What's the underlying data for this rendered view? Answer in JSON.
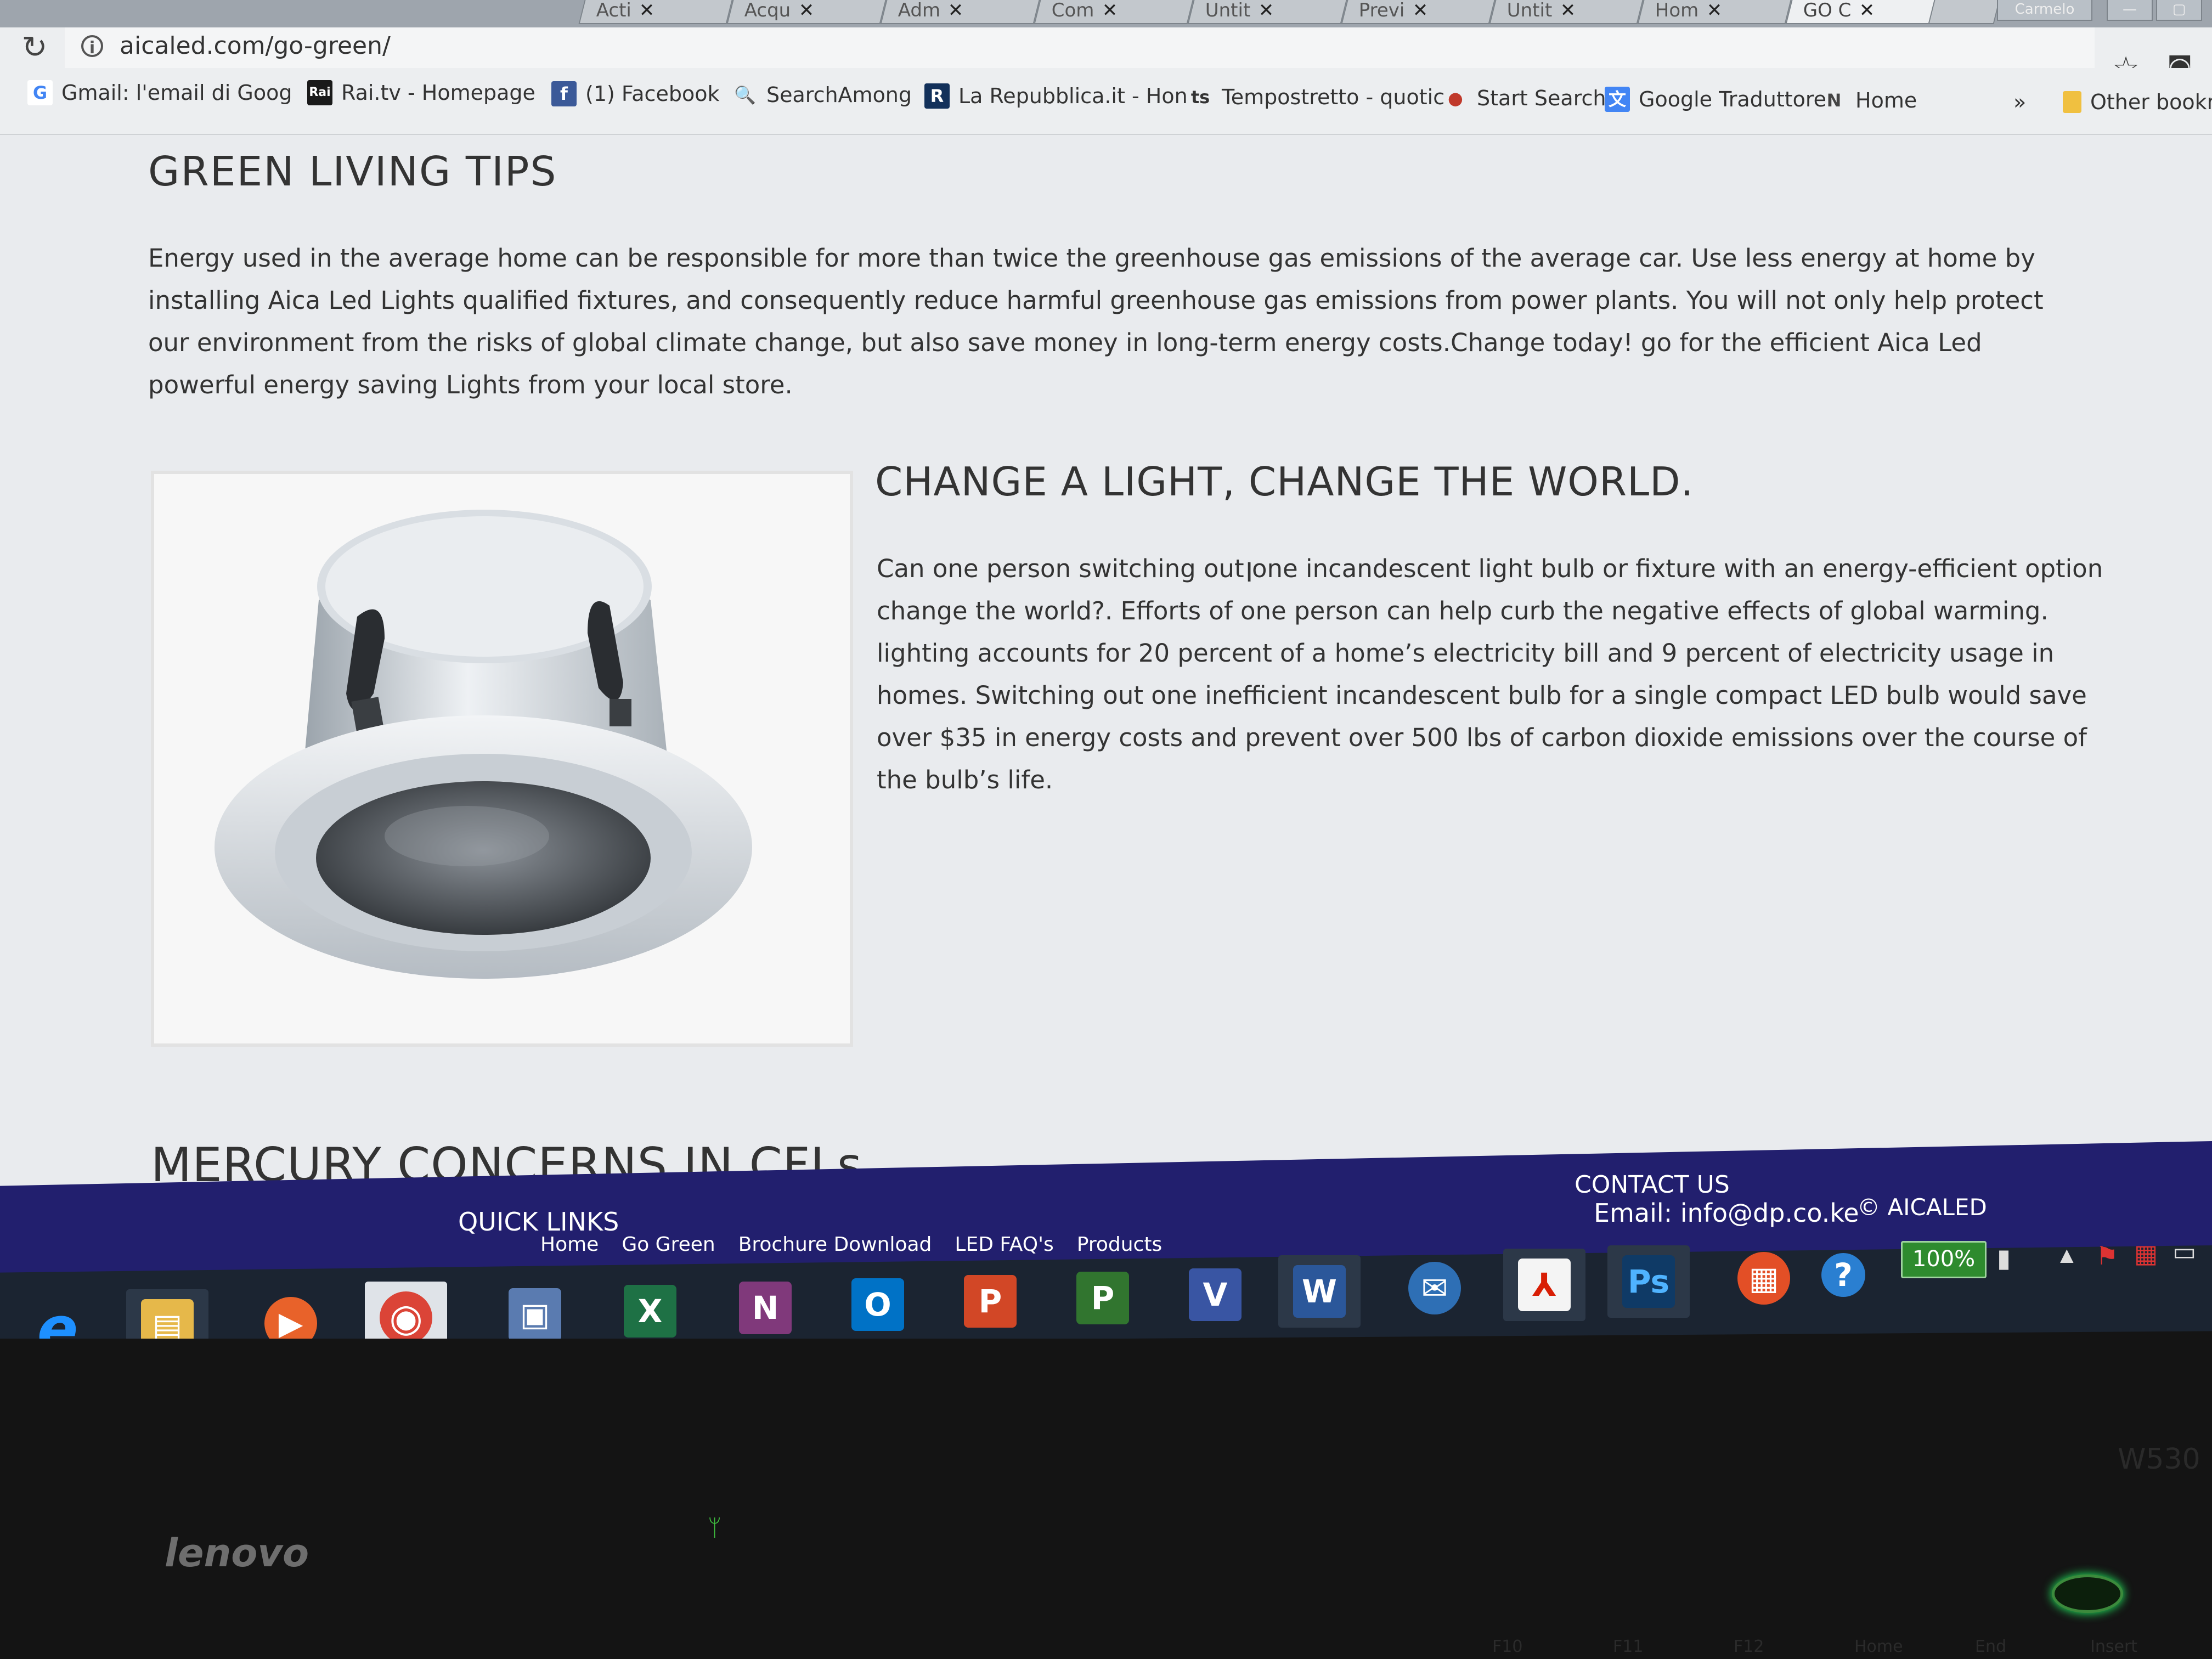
{
  "browser": {
    "tabs": [
      {
        "label": "Acti",
        "icon": "generic-tab-icon"
      },
      {
        "label": "Acqu",
        "icon": "google-icon"
      },
      {
        "label": "Adm",
        "icon": "admin-icon"
      },
      {
        "label": "Com",
        "icon": "pdf-icon"
      },
      {
        "label": "Untit",
        "icon": "doc-icon"
      },
      {
        "label": "Previ",
        "icon": "google-icon"
      },
      {
        "label": "Untit",
        "icon": "doc-icon"
      },
      {
        "label": "Hom",
        "icon": "doc-icon"
      },
      {
        "label": "GO C",
        "icon": "page-icon"
      }
    ],
    "profile_button": "Carmelo",
    "url": "aicaled.com/go-green/",
    "bookmarks": [
      {
        "label": "Gmail: l'email di Goog",
        "icon": "G",
        "color": "#4285f4"
      },
      {
        "label": "Rai.tv - Homepage",
        "icon": "Rai",
        "color": "#1a1a1a"
      },
      {
        "label": "(1) Facebook",
        "icon": "f",
        "color": "#3b5998"
      },
      {
        "label": "SearchAmong",
        "icon": "🔍",
        "color": "#3a78c3"
      },
      {
        "label": "La Repubblica.it - Hon",
        "icon": "R",
        "color": "#12305a"
      },
      {
        "label": "Tempostretto - quotic",
        "icon": "ts",
        "color": "#333333"
      },
      {
        "label": "Start Search",
        "icon": "●",
        "color": "#c0392b"
      },
      {
        "label": "Google Traduttore",
        "icon": "文",
        "color": "#4285f4"
      },
      {
        "label": "Home",
        "icon": "N",
        "color": "#444444"
      }
    ],
    "bookmarks_overflow": "»",
    "other_bookmarks": "Other bookma"
  },
  "page": {
    "title": "GREEN LIVING TIPS",
    "intro": "Energy used in the average home can be responsible for more than twice the greenhouse gas emissions of the average car. Use less energy at home by installing Aica Led Lights qualified fixtures, and consequently reduce harmful greenhouse gas emissions from power plants. You will not only help protect our environment from the risks of global climate change, but also save money in long-term energy costs.Change today! go for the efficient Aica Led powerful energy saving Lights from your local store.",
    "section_title": "CHANGE A LIGHT, CHANGE THE WORLD.",
    "section_text": "Can one person switching out one incandescent light bulb or fixture with an energy-efficient option change the world?. Efforts of one person can help curb the negative effects of global warming. lighting accounts for 20 percent of a home’s electricity bill and 9 percent of electricity usage in homes. Switching out one inefficient incandescent bulb for a single compact LED bulb would save over $35 in energy costs and prevent over 500 lbs of carbon dioxide emissions over the course of the bulb’s life.",
    "next_section_title": "MERCURY CONCERNS IN CFLs"
  },
  "footer": {
    "quick_links_title": "QUICK LINKS",
    "links": [
      "Home",
      "Go Green",
      "Brochure Download",
      "LED FAQ's",
      "Products"
    ],
    "contact_title": "CONTACT US",
    "email": "Email: info@dp.co.ke",
    "copyright": "© AICALED"
  },
  "taskbar": {
    "apps": [
      {
        "name": "internet-explorer-icon",
        "glyph": "e",
        "color": "#1e90ff"
      },
      {
        "name": "file-explorer-icon",
        "glyph": "▤",
        "color": "#e6b84a"
      },
      {
        "name": "media-player-icon",
        "glyph": "▶",
        "color": "#e8622a"
      },
      {
        "name": "chrome-icon",
        "glyph": "◉",
        "color": "#db4437"
      },
      {
        "name": "app-launcher-icon",
        "glyph": "▣",
        "color": "#5a7bb0"
      },
      {
        "name": "excel-icon",
        "glyph": "X",
        "color": "#1e7145"
      },
      {
        "name": "onenote-icon",
        "glyph": "N",
        "color": "#80397b"
      },
      {
        "name": "outlook-icon",
        "glyph": "O",
        "color": "#0072c6"
      },
      {
        "name": "powerpoint-icon",
        "glyph": "P",
        "color": "#d24726"
      },
      {
        "name": "project-icon",
        "glyph": "P",
        "color": "#31752f"
      },
      {
        "name": "visio-icon",
        "glyph": "V",
        "color": "#3955a3"
      },
      {
        "name": "word-icon",
        "glyph": "W",
        "color": "#2b579a"
      },
      {
        "name": "thunderbird-icon",
        "glyph": "✉",
        "color": "#2e6fb5"
      },
      {
        "name": "acrobat-icon",
        "glyph": "⅄",
        "color": "#d81e05"
      },
      {
        "name": "photoshop-icon",
        "glyph": "Ps",
        "color": "#0f3a66"
      },
      {
        "name": "office-icon",
        "glyph": "▦",
        "color": "#e34f26"
      },
      {
        "name": "help-icon",
        "glyph": "?",
        "color": "#2a7fd1"
      }
    ],
    "battery": "100%"
  },
  "hardware": {
    "brand": "lenovo",
    "model": "W530",
    "function_keys": [
      "F10",
      "F11",
      "F12",
      "Home",
      "End",
      "Insert"
    ]
  }
}
